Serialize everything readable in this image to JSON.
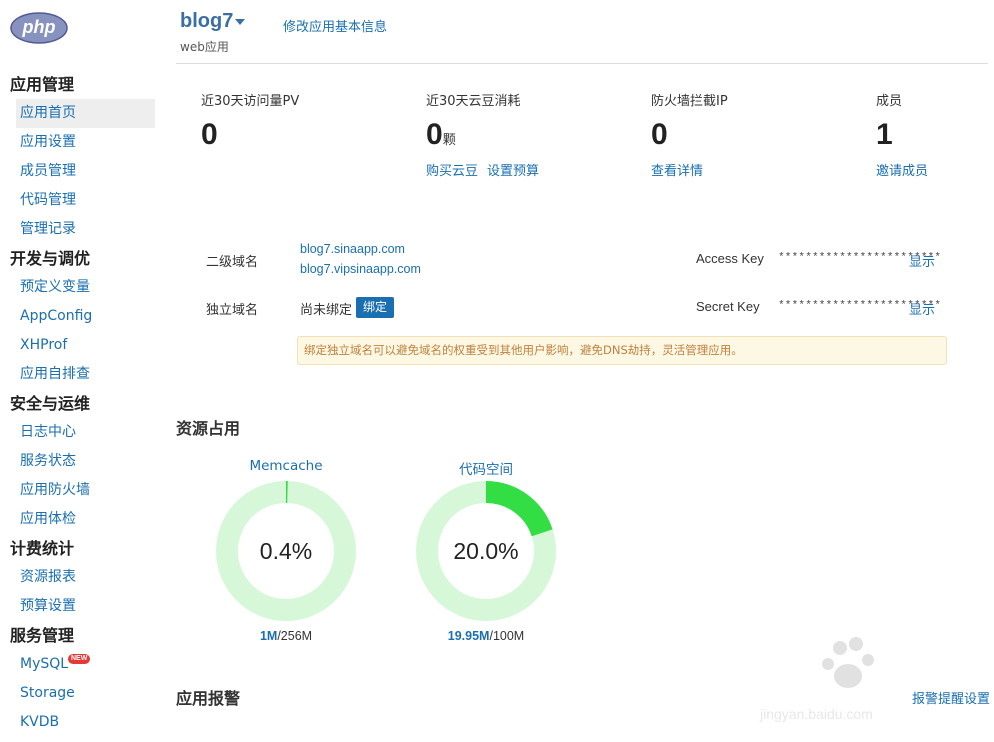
{
  "header": {
    "logo_text": "php",
    "app_name": "blog7",
    "app_type": "web应用",
    "edit_link": "修改应用基本信息"
  },
  "sidebar": {
    "sections": [
      {
        "title": "应用管理",
        "items": [
          "应用首页",
          "应用设置",
          "成员管理",
          "代码管理",
          "管理记录"
        ]
      },
      {
        "title": "开发与调优",
        "items": [
          "预定义变量",
          "AppConfig",
          "XHProf",
          "应用自排查"
        ]
      },
      {
        "title": "安全与运维",
        "items": [
          "日志中心",
          "服务状态",
          "应用防火墙",
          "应用体检"
        ]
      },
      {
        "title": "计费统计",
        "items": [
          "资源报表",
          "预算设置"
        ]
      },
      {
        "title": "服务管理",
        "items": [
          "MySQL",
          "Storage",
          "KVDB"
        ]
      }
    ],
    "new_badge": "NEW",
    "active_item": "应用首页"
  },
  "stats": [
    {
      "label": "近30天访问量PV",
      "value": "0",
      "unit": "",
      "links": []
    },
    {
      "label": "近30天云豆消耗",
      "value": "0",
      "unit": "颗",
      "links": [
        "购买云豆",
        "设置预算"
      ]
    },
    {
      "label": "防火墙拦截IP",
      "value": "0",
      "unit": "",
      "links": [
        "查看详情"
      ]
    },
    {
      "label": "成员",
      "value": "1",
      "unit": "",
      "links": [
        "邀请成员"
      ]
    }
  ],
  "domains": {
    "second_level_label": "二级域名",
    "second_level": [
      "blog7.sinaapp.com",
      "blog7.vipsinaapp.com"
    ],
    "independent_label": "独立域名",
    "independent_value": "尚未绑定",
    "bind_button": "绑定",
    "notice": "绑定独立域名可以避免域名的权重受到其他用户影响，避免DNS劫持，灵活管理应用。"
  },
  "keys": {
    "access_label": "Access Key",
    "access_mask": "************************",
    "secret_label": "Secret Key",
    "secret_mask": "************************",
    "show_label": "显示"
  },
  "resources": {
    "title": "资源占用",
    "gauges": [
      {
        "name": "Memcache",
        "percent_text": "0.4%",
        "fraction": 0.004,
        "used": "1M",
        "total": "/256M"
      },
      {
        "name": "代码空间",
        "percent_text": "20.0%",
        "fraction": 0.2,
        "used": "19.95M",
        "total": "/100M"
      }
    ],
    "colors": {
      "track": "#d6f8d8",
      "fill": "#33dd44"
    }
  },
  "alerts": {
    "title": "应用报警",
    "settings_link": "报警提醒设置"
  },
  "watermark": {
    "text": "jingyan.baidu.com"
  }
}
